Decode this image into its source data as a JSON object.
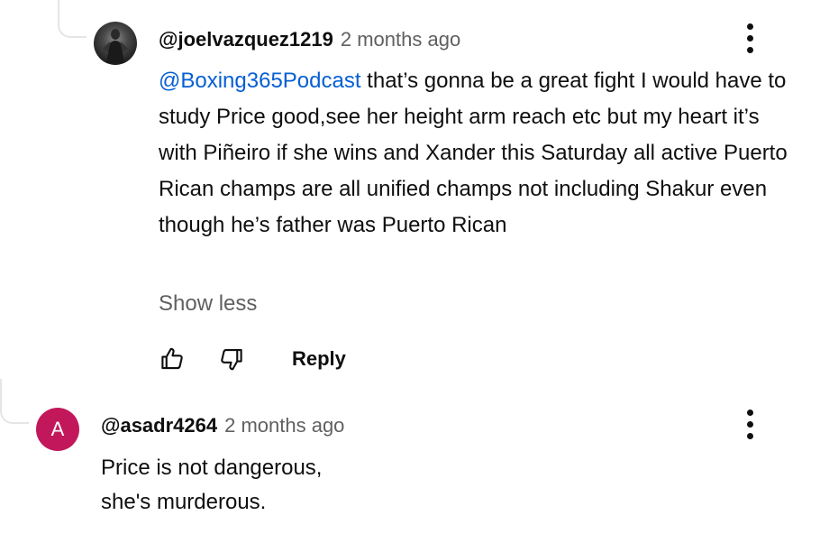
{
  "comments": [
    {
      "handle": "@joelvazquez1219",
      "time": "2 months ago",
      "mention": "@Boxing365Podcast",
      "text": " that’s gonna be a great fight I would have to study Price good,see her height arm reach etc but my heart it’s with Piñeiro if she wins and Xander this Saturday all active Puerto Rican champs are all unified champs not including Shakur even though he’s father was Puerto Rican",
      "show_less_label": "Show less",
      "reply_label": "Reply",
      "avatar_icon": "profile-photo"
    },
    {
      "handle": "@asadr4264",
      "time": "2 months ago",
      "avatar_letter": "A",
      "avatar_color": "#c2185b",
      "text_lines": [
        "Price is not dangerous,",
        "she's murderous."
      ]
    }
  ],
  "colors": {
    "mention": "#065fd4",
    "secondary_text": "#606060",
    "primary_text": "#0f0f0f"
  },
  "icons": [
    "thumbs-up-icon",
    "thumbs-down-icon",
    "more-vert-icon"
  ]
}
